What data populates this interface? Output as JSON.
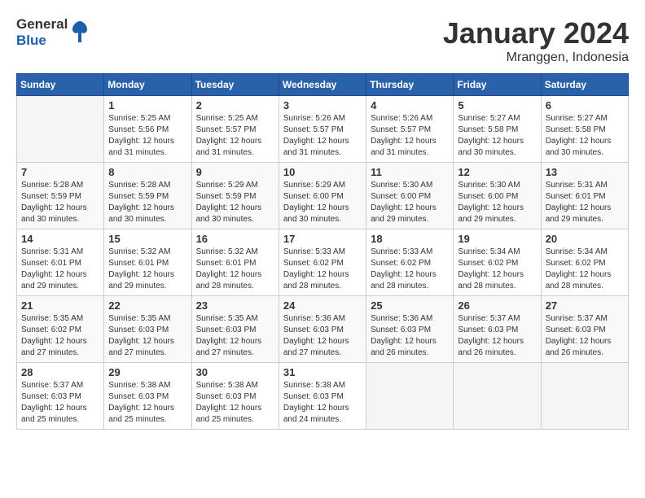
{
  "header": {
    "logo_general": "General",
    "logo_blue": "Blue",
    "month_title": "January 2024",
    "location": "Mranggen, Indonesia"
  },
  "columns": [
    "Sunday",
    "Monday",
    "Tuesday",
    "Wednesday",
    "Thursday",
    "Friday",
    "Saturday"
  ],
  "weeks": [
    [
      {
        "day": "",
        "info": ""
      },
      {
        "day": "1",
        "info": "Sunrise: 5:25 AM\nSunset: 5:56 PM\nDaylight: 12 hours\nand 31 minutes."
      },
      {
        "day": "2",
        "info": "Sunrise: 5:25 AM\nSunset: 5:57 PM\nDaylight: 12 hours\nand 31 minutes."
      },
      {
        "day": "3",
        "info": "Sunrise: 5:26 AM\nSunset: 5:57 PM\nDaylight: 12 hours\nand 31 minutes."
      },
      {
        "day": "4",
        "info": "Sunrise: 5:26 AM\nSunset: 5:57 PM\nDaylight: 12 hours\nand 31 minutes."
      },
      {
        "day": "5",
        "info": "Sunrise: 5:27 AM\nSunset: 5:58 PM\nDaylight: 12 hours\nand 30 minutes."
      },
      {
        "day": "6",
        "info": "Sunrise: 5:27 AM\nSunset: 5:58 PM\nDaylight: 12 hours\nand 30 minutes."
      }
    ],
    [
      {
        "day": "7",
        "info": "Sunrise: 5:28 AM\nSunset: 5:59 PM\nDaylight: 12 hours\nand 30 minutes."
      },
      {
        "day": "8",
        "info": "Sunrise: 5:28 AM\nSunset: 5:59 PM\nDaylight: 12 hours\nand 30 minutes."
      },
      {
        "day": "9",
        "info": "Sunrise: 5:29 AM\nSunset: 5:59 PM\nDaylight: 12 hours\nand 30 minutes."
      },
      {
        "day": "10",
        "info": "Sunrise: 5:29 AM\nSunset: 6:00 PM\nDaylight: 12 hours\nand 30 minutes."
      },
      {
        "day": "11",
        "info": "Sunrise: 5:30 AM\nSunset: 6:00 PM\nDaylight: 12 hours\nand 29 minutes."
      },
      {
        "day": "12",
        "info": "Sunrise: 5:30 AM\nSunset: 6:00 PM\nDaylight: 12 hours\nand 29 minutes."
      },
      {
        "day": "13",
        "info": "Sunrise: 5:31 AM\nSunset: 6:01 PM\nDaylight: 12 hours\nand 29 minutes."
      }
    ],
    [
      {
        "day": "14",
        "info": "Sunrise: 5:31 AM\nSunset: 6:01 PM\nDaylight: 12 hours\nand 29 minutes."
      },
      {
        "day": "15",
        "info": "Sunrise: 5:32 AM\nSunset: 6:01 PM\nDaylight: 12 hours\nand 29 minutes."
      },
      {
        "day": "16",
        "info": "Sunrise: 5:32 AM\nSunset: 6:01 PM\nDaylight: 12 hours\nand 28 minutes."
      },
      {
        "day": "17",
        "info": "Sunrise: 5:33 AM\nSunset: 6:02 PM\nDaylight: 12 hours\nand 28 minutes."
      },
      {
        "day": "18",
        "info": "Sunrise: 5:33 AM\nSunset: 6:02 PM\nDaylight: 12 hours\nand 28 minutes."
      },
      {
        "day": "19",
        "info": "Sunrise: 5:34 AM\nSunset: 6:02 PM\nDaylight: 12 hours\nand 28 minutes."
      },
      {
        "day": "20",
        "info": "Sunrise: 5:34 AM\nSunset: 6:02 PM\nDaylight: 12 hours\nand 28 minutes."
      }
    ],
    [
      {
        "day": "21",
        "info": "Sunrise: 5:35 AM\nSunset: 6:02 PM\nDaylight: 12 hours\nand 27 minutes."
      },
      {
        "day": "22",
        "info": "Sunrise: 5:35 AM\nSunset: 6:03 PM\nDaylight: 12 hours\nand 27 minutes."
      },
      {
        "day": "23",
        "info": "Sunrise: 5:35 AM\nSunset: 6:03 PM\nDaylight: 12 hours\nand 27 minutes."
      },
      {
        "day": "24",
        "info": "Sunrise: 5:36 AM\nSunset: 6:03 PM\nDaylight: 12 hours\nand 27 minutes."
      },
      {
        "day": "25",
        "info": "Sunrise: 5:36 AM\nSunset: 6:03 PM\nDaylight: 12 hours\nand 26 minutes."
      },
      {
        "day": "26",
        "info": "Sunrise: 5:37 AM\nSunset: 6:03 PM\nDaylight: 12 hours\nand 26 minutes."
      },
      {
        "day": "27",
        "info": "Sunrise: 5:37 AM\nSunset: 6:03 PM\nDaylight: 12 hours\nand 26 minutes."
      }
    ],
    [
      {
        "day": "28",
        "info": "Sunrise: 5:37 AM\nSunset: 6:03 PM\nDaylight: 12 hours\nand 25 minutes."
      },
      {
        "day": "29",
        "info": "Sunrise: 5:38 AM\nSunset: 6:03 PM\nDaylight: 12 hours\nand 25 minutes."
      },
      {
        "day": "30",
        "info": "Sunrise: 5:38 AM\nSunset: 6:03 PM\nDaylight: 12 hours\nand 25 minutes."
      },
      {
        "day": "31",
        "info": "Sunrise: 5:38 AM\nSunset: 6:03 PM\nDaylight: 12 hours\nand 24 minutes."
      },
      {
        "day": "",
        "info": ""
      },
      {
        "day": "",
        "info": ""
      },
      {
        "day": "",
        "info": ""
      }
    ]
  ]
}
